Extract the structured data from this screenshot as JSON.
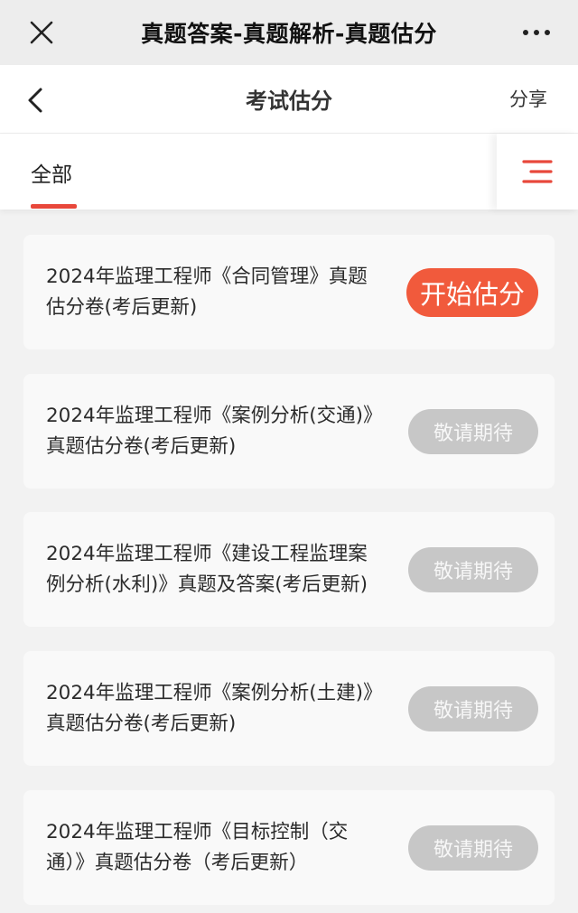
{
  "topbar": {
    "title": "真题答案-真题解析-真题估分",
    "close_icon": "close-icon",
    "more_icon": "more-icon"
  },
  "navbar": {
    "title": "考试估分",
    "share": "分享",
    "back_icon": "chevron-left-icon"
  },
  "tabs": {
    "active_tab": "全部",
    "menu_icon": "menu-icon"
  },
  "colors": {
    "accent": "#e8483b",
    "active_button": "#f15a3c",
    "disabled_button": "#c7c7c7"
  },
  "items": [
    {
      "title": "2024年监理工程师《合同管理》真题估分卷(考后更新)",
      "button": "开始估分",
      "state": "active"
    },
    {
      "title": "2024年监理工程师《案例分析(交通)》真题估分卷(考后更新)",
      "button": "敬请期待",
      "state": "disabled"
    },
    {
      "title": "2024年监理工程师《建设工程监理案例分析(水利)》真题及答案(考后更新)",
      "button": "敬请期待",
      "state": "disabled"
    },
    {
      "title": "2024年监理工程师《案例分析(土建)》真题估分卷(考后更新)",
      "button": "敬请期待",
      "state": "disabled"
    },
    {
      "title": "2024年监理工程师《目标控制（交通）》真题估分卷（考后更新）",
      "button": "敬请期待",
      "state": "disabled"
    }
  ]
}
